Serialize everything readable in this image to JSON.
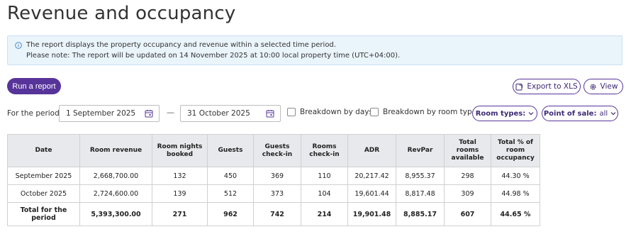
{
  "page": {
    "title": "Revenue and occupancy"
  },
  "info": {
    "line1": "The report displays the property occupancy and revenue within a selected time period.",
    "line2": "Please note: The report will be updated on 14 November 2025 at 10:00 local property time (UTC+04:00)."
  },
  "toolbar": {
    "run_label": "Run a report",
    "export_label": "Export to XLS",
    "view_label": "View"
  },
  "filters": {
    "period_label": "For the period",
    "date_from": "1 September 2025",
    "separator": "—",
    "date_to": "31 October 2025",
    "breakdown_days": "Breakdown by days",
    "breakdown_room_types": "Breakdown by room types",
    "room_types_label": "Room types:",
    "point_of_sale_label": "Point of sale:",
    "point_of_sale_value": "all"
  },
  "table": {
    "headers": [
      "Date",
      "Room revenue",
      "Room nights booked",
      "Guests",
      "Guests check-in",
      "Rooms check-in",
      "ADR",
      "RevPar",
      "Total rooms available",
      "Total % of room occupancy"
    ],
    "rows": [
      [
        "September 2025",
        "2,668,700.00",
        "132",
        "450",
        "369",
        "110",
        "20,217.42",
        "8,955.37",
        "298",
        "44.30 %"
      ],
      [
        "October 2025",
        "2,724,600.00",
        "139",
        "512",
        "373",
        "104",
        "19,601.44",
        "8,817.48",
        "309",
        "44.98 %"
      ]
    ],
    "total": [
      "Total for the period",
      "5,393,300.00",
      "271",
      "962",
      "742",
      "214",
      "19,901.48",
      "8,885.17",
      "607",
      "44.65 %"
    ]
  },
  "colors": {
    "accent": "#57349a",
    "info_bg": "#eaf4fb",
    "header_bg": "#e7e9ec"
  }
}
